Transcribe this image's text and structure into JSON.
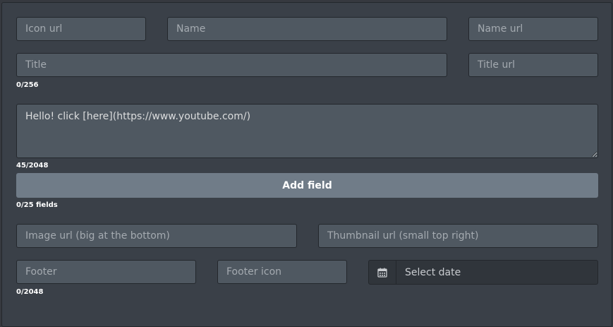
{
  "author": {
    "icon_url_placeholder": "Icon url",
    "name_placeholder": "Name",
    "name_url_placeholder": "Name url"
  },
  "title": {
    "placeholder": "Title",
    "url_placeholder": "Title url",
    "counter": "0/256"
  },
  "description": {
    "value": "Hello! click [here](https://www.youtube.com/)",
    "counter": "45/2048"
  },
  "fields": {
    "add_label": "Add field",
    "counter": "0/25 fields"
  },
  "images": {
    "image_url_placeholder": "Image url (big at the bottom)",
    "thumbnail_url_placeholder": "Thumbnail url (small top right)"
  },
  "footer": {
    "text_placeholder": "Footer",
    "icon_placeholder": "Footer icon",
    "date_placeholder": "Select date",
    "date_icon": "calendar-icon",
    "counter": "0/2048"
  },
  "colors": {
    "background": "#3a4048",
    "input_bg": "#4f5861",
    "button_bg": "#707c88",
    "border": "#23272c"
  }
}
